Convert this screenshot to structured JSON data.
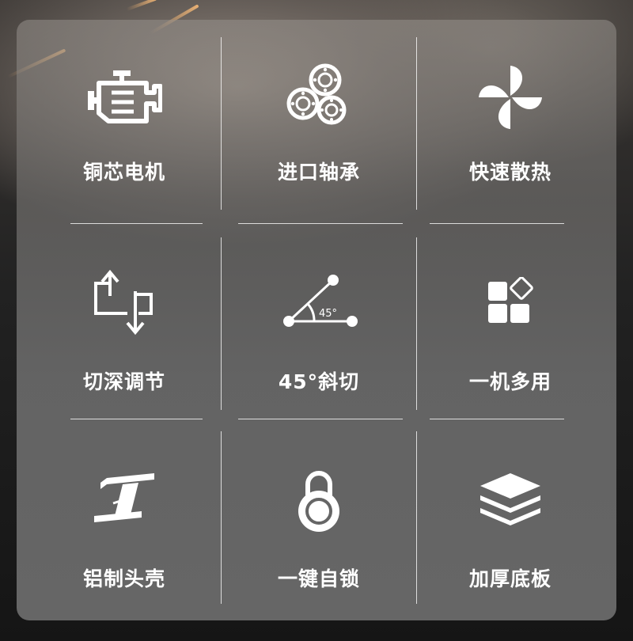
{
  "features": [
    {
      "label": "铜芯电机",
      "icon": "engine-icon"
    },
    {
      "label": "进口轴承",
      "icon": "bearing-icon"
    },
    {
      "label": "快速散热",
      "icon": "fan-icon"
    },
    {
      "label": "切深调节",
      "icon": "depth-adjust-icon"
    },
    {
      "label": "45°斜切",
      "icon": "bevel-angle-icon",
      "angle_text": "45°"
    },
    {
      "label": "一机多用",
      "icon": "multi-use-icon"
    },
    {
      "label": "铝制头壳",
      "icon": "aluminum-beam-icon"
    },
    {
      "label": "一键自锁",
      "icon": "lock-icon"
    },
    {
      "label": "加厚底板",
      "icon": "layers-icon"
    }
  ]
}
